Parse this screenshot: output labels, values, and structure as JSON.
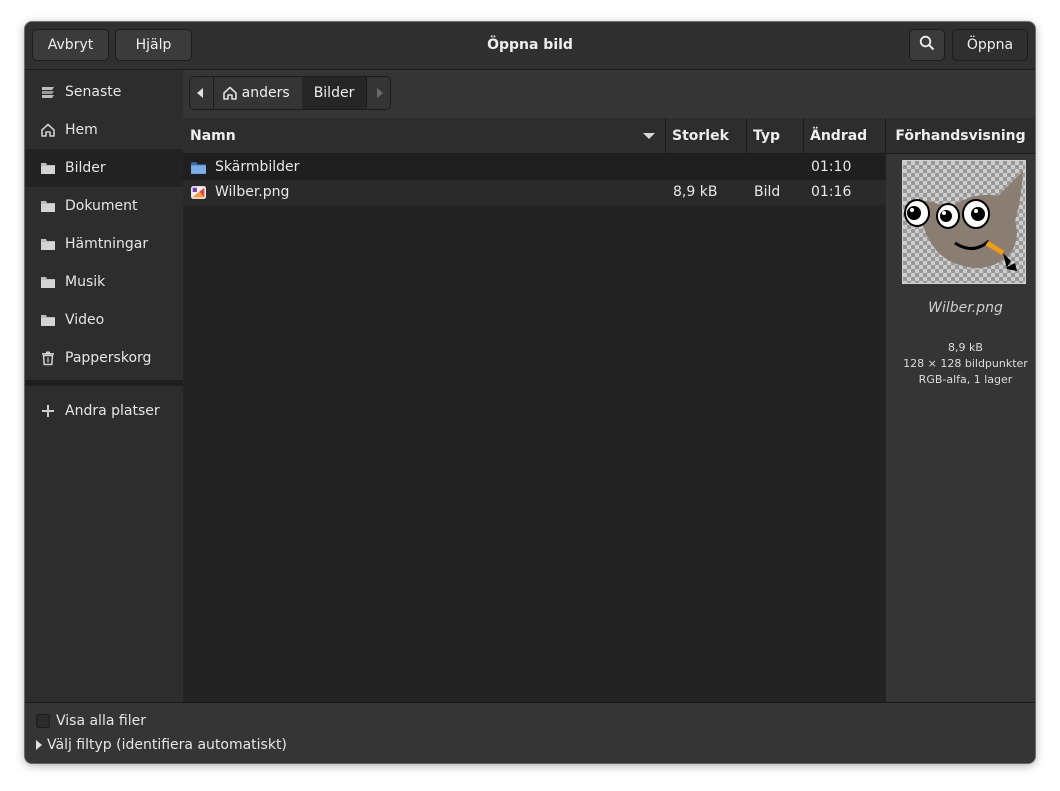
{
  "window": {
    "title": "Öppna bild"
  },
  "header": {
    "cancel_label": "Avbryt",
    "help_label": "Hjälp",
    "open_label": "Öppna",
    "search_icon": "search-icon"
  },
  "sidebar": {
    "items": [
      {
        "label": "Senaste",
        "icon": "recent-icon"
      },
      {
        "label": "Hem",
        "icon": "home-icon"
      },
      {
        "label": "Bilder",
        "icon": "folder-icon"
      },
      {
        "label": "Dokument",
        "icon": "folder-icon"
      },
      {
        "label": "Hämtningar",
        "icon": "folder-icon"
      },
      {
        "label": "Musik",
        "icon": "folder-icon"
      },
      {
        "label": "Video",
        "icon": "folder-icon"
      },
      {
        "label": "Papperskorg",
        "icon": "trash-icon"
      }
    ],
    "other_places": "Andra platser"
  },
  "pathbar": {
    "segments": [
      {
        "label": "anders",
        "icon": "home-icon"
      },
      {
        "label": "Bilder"
      }
    ]
  },
  "filelist": {
    "columns": [
      "Namn",
      "Storlek",
      "Typ",
      "Ändrad"
    ],
    "rows": [
      {
        "name": "Skärmbilder",
        "size": "",
        "type": "",
        "modified": "01:10",
        "icon": "folder-icon"
      },
      {
        "name": "Wilber.png",
        "size": "8,9 kB",
        "type": "Bild",
        "modified": "01:16",
        "icon": "image-file-icon"
      }
    ]
  },
  "preview": {
    "title": "Förhandsvisning",
    "name": "Wilber.png",
    "size": "8,9 kB",
    "dimensions": "128 × 128 bildpunkter",
    "details": "RGB-alfa, 1 lager"
  },
  "footer": {
    "show_all_label": "Visa alla filer",
    "show_all_checked": false,
    "filetype_label": "Välj filtyp (identifiera automatiskt)"
  }
}
